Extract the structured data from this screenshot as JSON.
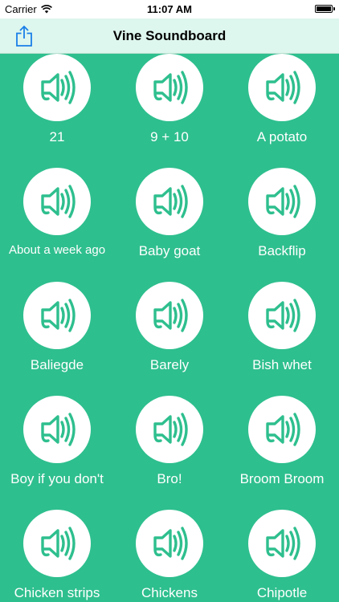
{
  "status_bar": {
    "carrier": "Carrier",
    "time": "11:07 AM"
  },
  "nav_bar": {
    "title": "Vine Soundboard",
    "share_icon": "share-icon"
  },
  "colors": {
    "background": "#2ebf8e",
    "accent": "#2ebf8e",
    "nav_background": "#ddf6ee",
    "share_tint": "#1a7fe8"
  },
  "sounds": [
    {
      "label": "21",
      "icon": "speaker-icon"
    },
    {
      "label": "9 + 10",
      "icon": "speaker-icon"
    },
    {
      "label": "A potato",
      "icon": "speaker-icon"
    },
    {
      "label": "About a week ago",
      "icon": "speaker-icon"
    },
    {
      "label": "Baby goat",
      "icon": "speaker-icon"
    },
    {
      "label": "Backflip",
      "icon": "speaker-icon"
    },
    {
      "label": "Baliegde",
      "icon": "speaker-icon"
    },
    {
      "label": "Barely",
      "icon": "speaker-icon"
    },
    {
      "label": "Bish whet",
      "icon": "speaker-icon"
    },
    {
      "label": "Boy if you don't",
      "icon": "speaker-icon"
    },
    {
      "label": "Bro!",
      "icon": "speaker-icon"
    },
    {
      "label": "Broom Broom",
      "icon": "speaker-icon"
    },
    {
      "label": "Chicken strips",
      "icon": "speaker-icon"
    },
    {
      "label": "Chickens",
      "icon": "speaker-icon"
    },
    {
      "label": "Chipotle",
      "icon": "speaker-icon"
    }
  ]
}
